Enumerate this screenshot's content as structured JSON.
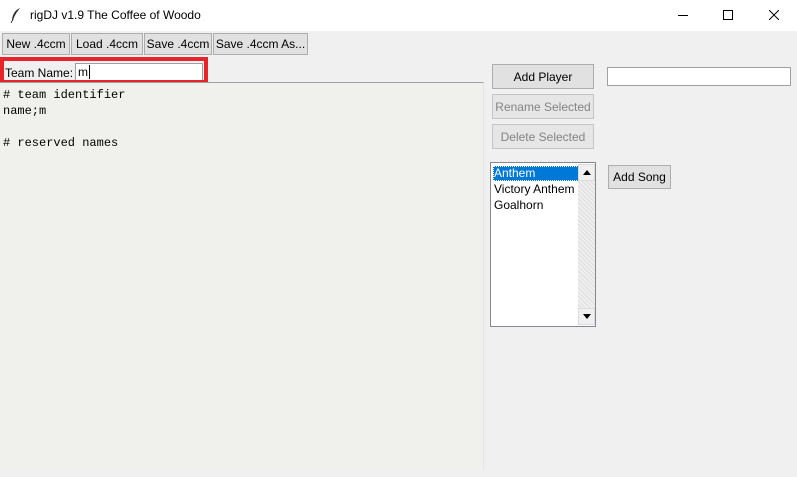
{
  "window": {
    "title": "rigDJ v1.9 The Coffee of Woodo",
    "controls": {
      "minimize": "minimize-icon",
      "maximize": "maximize-icon",
      "close": "close-icon"
    }
  },
  "toolbar": {
    "new_label": "New .4ccm",
    "load_label": "Load .4ccm",
    "save_label": "Save .4ccm",
    "save_as_label": "Save .4ccm As..."
  },
  "team": {
    "label": "Team Name:",
    "value": "m"
  },
  "editor": {
    "lines": [
      "# team identifier",
      "name;m",
      "",
      "# reserved names"
    ]
  },
  "players": {
    "add_label": "Add Player",
    "name_value": "",
    "rename_label": "Rename Selected",
    "delete_label": "Delete Selected"
  },
  "songs": {
    "items": [
      "Anthem",
      "Victory Anthem",
      "Goalhorn"
    ],
    "selected": "Anthem",
    "add_label": "Add Song"
  },
  "colors": {
    "highlight": "#e8242b",
    "selection": "#0078d7"
  }
}
